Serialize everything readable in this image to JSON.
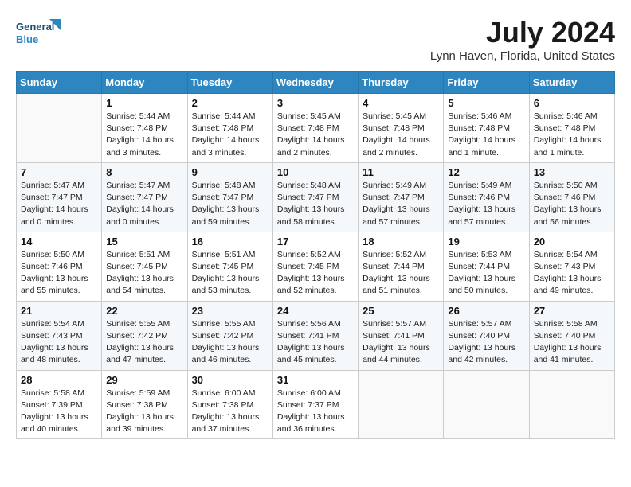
{
  "header": {
    "logo_line1": "General",
    "logo_line2": "Blue",
    "month": "July 2024",
    "location": "Lynn Haven, Florida, United States"
  },
  "days_of_week": [
    "Sunday",
    "Monday",
    "Tuesday",
    "Wednesday",
    "Thursday",
    "Friday",
    "Saturday"
  ],
  "weeks": [
    [
      {
        "day": "",
        "info": ""
      },
      {
        "day": "1",
        "info": "Sunrise: 5:44 AM\nSunset: 7:48 PM\nDaylight: 14 hours\nand 3 minutes."
      },
      {
        "day": "2",
        "info": "Sunrise: 5:44 AM\nSunset: 7:48 PM\nDaylight: 14 hours\nand 3 minutes."
      },
      {
        "day": "3",
        "info": "Sunrise: 5:45 AM\nSunset: 7:48 PM\nDaylight: 14 hours\nand 2 minutes."
      },
      {
        "day": "4",
        "info": "Sunrise: 5:45 AM\nSunset: 7:48 PM\nDaylight: 14 hours\nand 2 minutes."
      },
      {
        "day": "5",
        "info": "Sunrise: 5:46 AM\nSunset: 7:48 PM\nDaylight: 14 hours\nand 1 minute."
      },
      {
        "day": "6",
        "info": "Sunrise: 5:46 AM\nSunset: 7:48 PM\nDaylight: 14 hours\nand 1 minute."
      }
    ],
    [
      {
        "day": "7",
        "info": "Sunrise: 5:47 AM\nSunset: 7:47 PM\nDaylight: 14 hours\nand 0 minutes."
      },
      {
        "day": "8",
        "info": "Sunrise: 5:47 AM\nSunset: 7:47 PM\nDaylight: 14 hours\nand 0 minutes."
      },
      {
        "day": "9",
        "info": "Sunrise: 5:48 AM\nSunset: 7:47 PM\nDaylight: 13 hours\nand 59 minutes."
      },
      {
        "day": "10",
        "info": "Sunrise: 5:48 AM\nSunset: 7:47 PM\nDaylight: 13 hours\nand 58 minutes."
      },
      {
        "day": "11",
        "info": "Sunrise: 5:49 AM\nSunset: 7:47 PM\nDaylight: 13 hours\nand 57 minutes."
      },
      {
        "day": "12",
        "info": "Sunrise: 5:49 AM\nSunset: 7:46 PM\nDaylight: 13 hours\nand 57 minutes."
      },
      {
        "day": "13",
        "info": "Sunrise: 5:50 AM\nSunset: 7:46 PM\nDaylight: 13 hours\nand 56 minutes."
      }
    ],
    [
      {
        "day": "14",
        "info": "Sunrise: 5:50 AM\nSunset: 7:46 PM\nDaylight: 13 hours\nand 55 minutes."
      },
      {
        "day": "15",
        "info": "Sunrise: 5:51 AM\nSunset: 7:45 PM\nDaylight: 13 hours\nand 54 minutes."
      },
      {
        "day": "16",
        "info": "Sunrise: 5:51 AM\nSunset: 7:45 PM\nDaylight: 13 hours\nand 53 minutes."
      },
      {
        "day": "17",
        "info": "Sunrise: 5:52 AM\nSunset: 7:45 PM\nDaylight: 13 hours\nand 52 minutes."
      },
      {
        "day": "18",
        "info": "Sunrise: 5:52 AM\nSunset: 7:44 PM\nDaylight: 13 hours\nand 51 minutes."
      },
      {
        "day": "19",
        "info": "Sunrise: 5:53 AM\nSunset: 7:44 PM\nDaylight: 13 hours\nand 50 minutes."
      },
      {
        "day": "20",
        "info": "Sunrise: 5:54 AM\nSunset: 7:43 PM\nDaylight: 13 hours\nand 49 minutes."
      }
    ],
    [
      {
        "day": "21",
        "info": "Sunrise: 5:54 AM\nSunset: 7:43 PM\nDaylight: 13 hours\nand 48 minutes."
      },
      {
        "day": "22",
        "info": "Sunrise: 5:55 AM\nSunset: 7:42 PM\nDaylight: 13 hours\nand 47 minutes."
      },
      {
        "day": "23",
        "info": "Sunrise: 5:55 AM\nSunset: 7:42 PM\nDaylight: 13 hours\nand 46 minutes."
      },
      {
        "day": "24",
        "info": "Sunrise: 5:56 AM\nSunset: 7:41 PM\nDaylight: 13 hours\nand 45 minutes."
      },
      {
        "day": "25",
        "info": "Sunrise: 5:57 AM\nSunset: 7:41 PM\nDaylight: 13 hours\nand 44 minutes."
      },
      {
        "day": "26",
        "info": "Sunrise: 5:57 AM\nSunset: 7:40 PM\nDaylight: 13 hours\nand 42 minutes."
      },
      {
        "day": "27",
        "info": "Sunrise: 5:58 AM\nSunset: 7:40 PM\nDaylight: 13 hours\nand 41 minutes."
      }
    ],
    [
      {
        "day": "28",
        "info": "Sunrise: 5:58 AM\nSunset: 7:39 PM\nDaylight: 13 hours\nand 40 minutes."
      },
      {
        "day": "29",
        "info": "Sunrise: 5:59 AM\nSunset: 7:38 PM\nDaylight: 13 hours\nand 39 minutes."
      },
      {
        "day": "30",
        "info": "Sunrise: 6:00 AM\nSunset: 7:38 PM\nDaylight: 13 hours\nand 37 minutes."
      },
      {
        "day": "31",
        "info": "Sunrise: 6:00 AM\nSunset: 7:37 PM\nDaylight: 13 hours\nand 36 minutes."
      },
      {
        "day": "",
        "info": ""
      },
      {
        "day": "",
        "info": ""
      },
      {
        "day": "",
        "info": ""
      }
    ]
  ]
}
